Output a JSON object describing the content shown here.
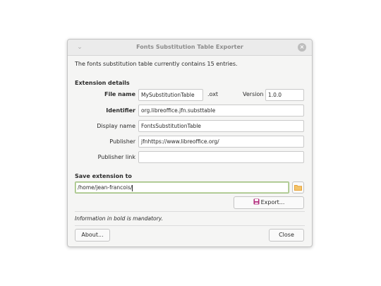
{
  "window": {
    "title": "Fonts Substitution Table Exporter",
    "close_icon": "close-icon",
    "menu_icon": "chevron-down-icon"
  },
  "intro": "The fonts substitution table currently contains 15 entries.",
  "extension": {
    "section_title": "Extension details",
    "file_name_label": "File name",
    "file_name_value": "MySubstitutionTable",
    "file_ext": ".oxt",
    "version_label": "Version",
    "version_value": "1.0.0",
    "identifier_label": "Identifier",
    "identifier_value": "org.libreoffice.jfn.substtable",
    "display_name_label": "Display name",
    "display_name_value": "FontsSubstitutionTable",
    "publisher_label": "Publisher",
    "publisher_value": "jfnhttps://www.libreoffice.org/",
    "publisher_link_label": "Publisher link",
    "publisher_link_value": ""
  },
  "save": {
    "section_title": "Save extension to",
    "path_value": "/home/jean-francois/",
    "browse_icon": "folder-icon",
    "export_label": "Export...",
    "export_icon": "save-icon"
  },
  "note": "Information in bold is mandatory.",
  "footer": {
    "about_label": "About...",
    "close_label": "Close"
  },
  "colors": {
    "accent_focus": "#9dbe7b",
    "folder": "#e8a23a",
    "save_icon": "#b0287a"
  }
}
